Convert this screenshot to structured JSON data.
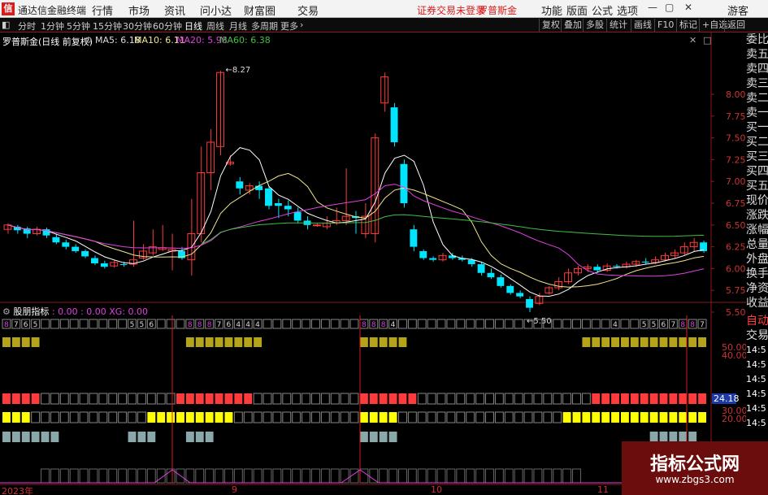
{
  "app": {
    "title": "通达信金融终端",
    "logo": "信"
  },
  "top_menu": [
    "行情",
    "市场",
    "资讯",
    "问小达",
    "财富圈",
    "交易"
  ],
  "warning": "证券交易未登录",
  "stock_name_top": "罗普斯金",
  "top_right": [
    "功能",
    "版面",
    "公式",
    "选项"
  ],
  "guest": "游客",
  "periods": [
    "分时",
    "1分钟",
    "5分钟",
    "15分钟",
    "30分钟",
    "60分钟",
    "日线",
    "周线",
    "月线",
    "多周期",
    "更多"
  ],
  "active_period": "日线",
  "toolbar_right": [
    "复权",
    "叠加",
    "多股",
    "统计",
    "画线",
    "F10",
    "标记",
    "+自选",
    "返回"
  ],
  "main_title": "罗普斯金(日线 前复权)",
  "ma": [
    {
      "label": "MA5: 6.18",
      "color": "#ffffff"
    },
    {
      "label": "MA10: 6.11",
      "color": "#f0e68c"
    },
    {
      "label": "MA20: 5.98",
      "color": "#e040e0"
    },
    {
      "label": "MA60: 6.38",
      "color": "#40c040"
    }
  ],
  "price_axis": [
    "8.00",
    "7.75",
    "7.50",
    "7.25",
    "7.00",
    "6.75",
    "6.50",
    "6.25",
    "6.00",
    "5.75",
    "5.50"
  ],
  "annotations": {
    "high": "8.27",
    "low": "5.50"
  },
  "indicator_title": "股朋指标",
  "indicator_values": ": 0.00 : 0.00 XG: 0.00",
  "ind_axis": [
    "50.00",
    "40.00",
    "30.00",
    "20.00"
  ],
  "ind_marker": "24.18",
  "right_panel": [
    "委比",
    "卖五",
    "卖四",
    "卖三",
    "卖二",
    "卖一",
    "买一",
    "买二",
    "买三",
    "买四",
    "买五",
    "现价",
    "涨跌",
    "涨幅",
    "总量",
    "外盘",
    "换手",
    "净资",
    "收益"
  ],
  "right_panel_lower": [
    "自动",
    "交易"
  ],
  "right_times": [
    "14:5",
    "14:5",
    "14:5",
    "14:5",
    "14:5",
    "14:5"
  ],
  "date_labels": [
    "2023年",
    "9",
    "10",
    "11"
  ],
  "number_row": "8765 ... 556 ... 88876444 ... 884 ... 4 ... 556788 7",
  "watermark": {
    "line1": "指标公式网",
    "line2": "www.zbgs3.com"
  },
  "colors": {
    "up": "#ff3b3b",
    "down": "#00e5ff",
    "yellow": "#ffff00",
    "olive": "#b5a319",
    "gray": "#8aa8aa",
    "accent": "#d71c1c"
  }
}
